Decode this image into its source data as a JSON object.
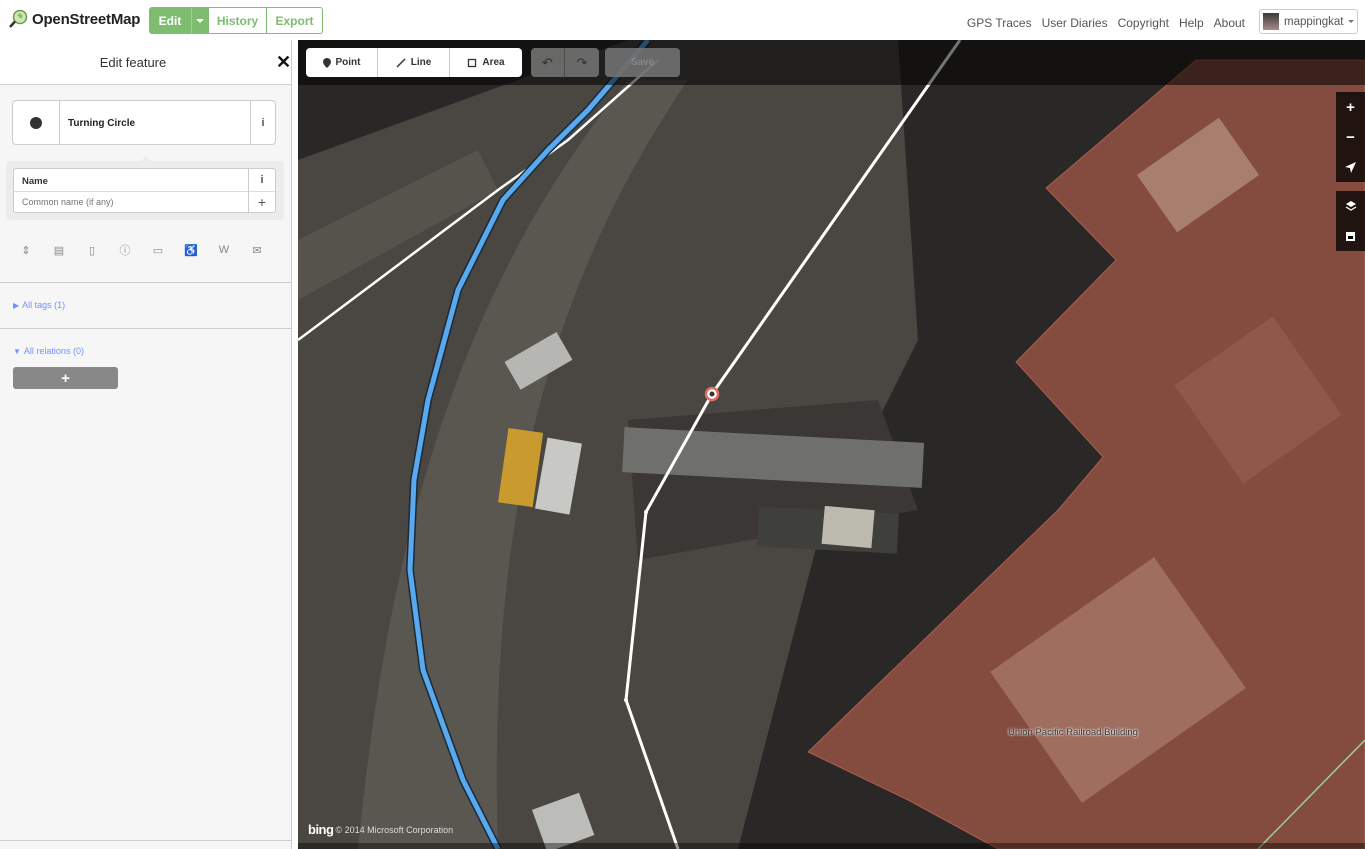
{
  "header": {
    "brand": "OpenStreetMap",
    "nav": {
      "edit": "Edit",
      "history": "History",
      "export": "Export"
    },
    "secondary": [
      "GPS Traces",
      "User Diaries",
      "Copyright",
      "Help",
      "About"
    ],
    "user": "mappingkat"
  },
  "sidebar": {
    "title": "Edit feature",
    "close": "✕",
    "preset": {
      "name": "Turning Circle",
      "info": "i"
    },
    "field": {
      "label": "Name",
      "info": "i",
      "placeholder": "Common name (if any)",
      "add": "+"
    },
    "icons": [
      "elevator-icon",
      "note-icon",
      "phone-icon",
      "info-icon",
      "website-icon",
      "wheelchair-icon",
      "wikipedia-icon",
      "email-icon"
    ],
    "all_tags": "All tags (1)",
    "all_relations": "All relations (0)",
    "add_relation": "+"
  },
  "toolbar": {
    "point": "Point",
    "line": "Line",
    "area": "Area",
    "undo": "↶",
    "redo": "↷",
    "save": "Save"
  },
  "map": {
    "controls": [
      "+",
      "−"
    ],
    "building_label": "Union Pacific Railroad Building",
    "attribution_brand": "bing",
    "attribution": "© 2014 Microsoft Corporation"
  }
}
